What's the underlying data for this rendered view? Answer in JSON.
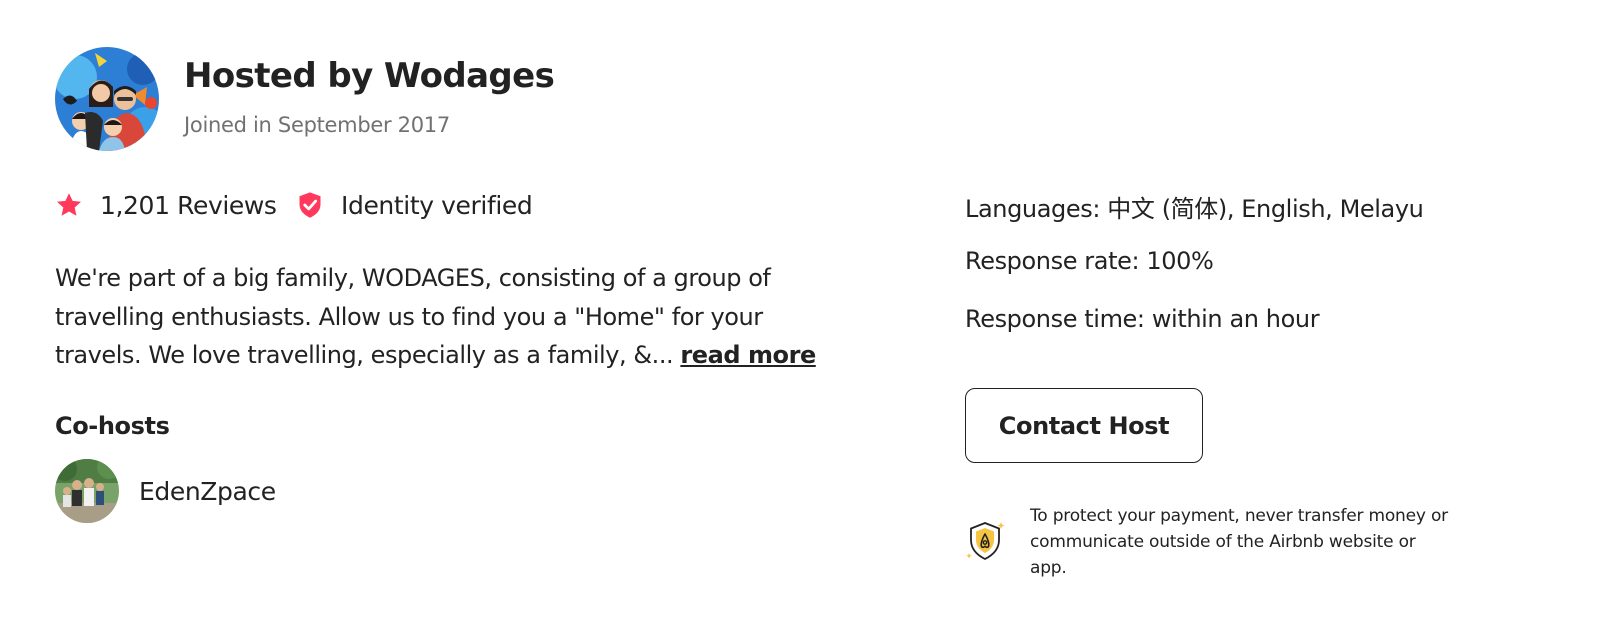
{
  "host": {
    "title": "Hosted by Wodages",
    "joined": "Joined in September 2017",
    "avatar": "host-family-photo"
  },
  "stats": {
    "reviews_label": "1,201 Reviews",
    "reviews_icon": "star-icon",
    "verified_label": "Identity verified",
    "verified_icon": "verified-shield-icon",
    "accent_color": "#FF385C"
  },
  "description": {
    "text": "We're part of a big family, WODAGES, consisting of a group of travelling enthusiasts. Allow us to find you a \"Home\" for your travels. We love travelling, especially as a family, &...",
    "read_more_label": "read more"
  },
  "cohosts": {
    "title": "Co-hosts",
    "items": [
      {
        "name": "EdenZpace",
        "avatar": "cohost-group-photo"
      }
    ]
  },
  "details": {
    "languages": "Languages: 中文 (简体), English, Melayu",
    "response_rate": "Response rate: 100%",
    "response_time": "Response time: within an hour"
  },
  "contact_button_label": "Contact Host",
  "payment_notice": {
    "icon": "airbnb-protection-shield-icon",
    "text": "To protect your payment, never transfer money or communicate outside of the Airbnb website or app."
  }
}
